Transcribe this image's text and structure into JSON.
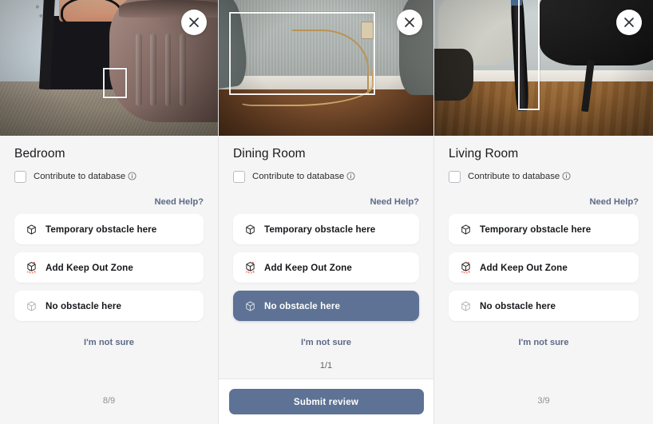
{
  "panels": [
    {
      "room": "Bedroom",
      "scene": "bedroom",
      "close_icon": "close-icon",
      "contribute": {
        "label": "Contribute to database",
        "info_icon": "info-icon",
        "checked": false
      },
      "help_label": "Need Help?",
      "options": [
        {
          "label": "Temporary obstacle here",
          "icon": "cube-icon",
          "selected": false
        },
        {
          "label": "Add Keep Out Zone",
          "icon": "cube-keepout-icon",
          "selected": false
        },
        {
          "label": "No obstacle here",
          "icon": "cube-outline-icon",
          "selected": false
        }
      ],
      "not_sure_label": "I'm not sure",
      "counter": "8/9",
      "has_submit": false
    },
    {
      "room": "Dining Room",
      "scene": "dining",
      "close_icon": "close-icon",
      "contribute": {
        "label": "Contribute to database",
        "info_icon": "info-icon",
        "checked": false
      },
      "help_label": "Need Help?",
      "options": [
        {
          "label": "Temporary obstacle here",
          "icon": "cube-icon",
          "selected": false
        },
        {
          "label": "Add Keep Out Zone",
          "icon": "cube-keepout-icon",
          "selected": false
        },
        {
          "label": "No obstacle here",
          "icon": "cube-outline-icon",
          "selected": true
        }
      ],
      "not_sure_label": "I'm not sure",
      "counter": "1/1",
      "has_submit": true,
      "submit_label": "Submit review"
    },
    {
      "room": "Living Room",
      "scene": "living",
      "close_icon": "close-icon",
      "contribute": {
        "label": "Contribute to database",
        "info_icon": "info-icon",
        "checked": false
      },
      "help_label": "Need Help?",
      "options": [
        {
          "label": "Temporary obstacle here",
          "icon": "cube-icon",
          "selected": false
        },
        {
          "label": "Add Keep Out Zone",
          "icon": "cube-keepout-icon",
          "selected": false
        },
        {
          "label": "No obstacle here",
          "icon": "cube-outline-icon",
          "selected": false
        }
      ],
      "not_sure_label": "I'm not sure",
      "counter": "3/9",
      "has_submit": false
    }
  ],
  "colors": {
    "accent": "#5d7294",
    "link": "#5d6a86",
    "panel_bg": "#f5f5f6",
    "card_bg": "#ffffff",
    "keepout": "#e0563c"
  }
}
